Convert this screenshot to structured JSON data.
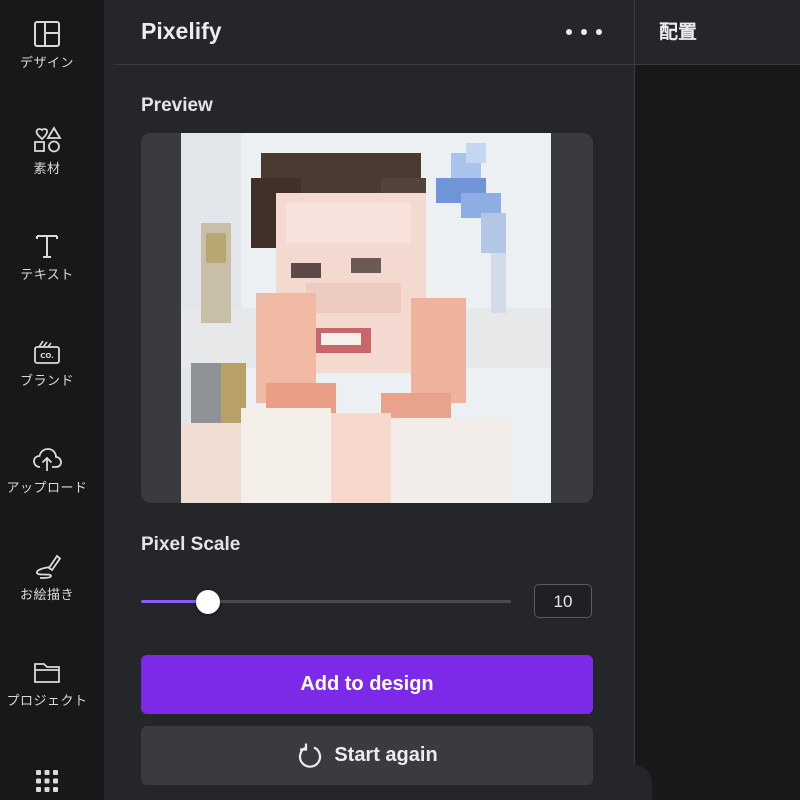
{
  "rail": {
    "items": [
      {
        "label": "デザイン",
        "icon": "layout-icon"
      },
      {
        "label": "素材",
        "icon": "elements-icon"
      },
      {
        "label": "テキスト",
        "icon": "text-icon"
      },
      {
        "label": "ブランド",
        "icon": "brand-icon"
      },
      {
        "label": "アップロード",
        "icon": "upload-icon"
      },
      {
        "label": "お絵描き",
        "icon": "draw-icon"
      },
      {
        "label": "プロジェクト",
        "icon": "folder-icon"
      }
    ],
    "apps_icon": "apps-grid-icon"
  },
  "panel": {
    "title": "Pixelify",
    "preview_label": "Preview",
    "pixel_scale_label": "Pixel Scale",
    "pixel_scale_value": "10",
    "pixel_scale_fraction": 0.18,
    "add_button": "Add to design",
    "start_again_button": "Start again"
  },
  "canvas": {
    "title": "配置"
  },
  "colors": {
    "accent": "#7d2ae8",
    "slider_fill": "#8b5cf6",
    "panel_bg": "#252629",
    "rail_bg": "#17181a"
  }
}
